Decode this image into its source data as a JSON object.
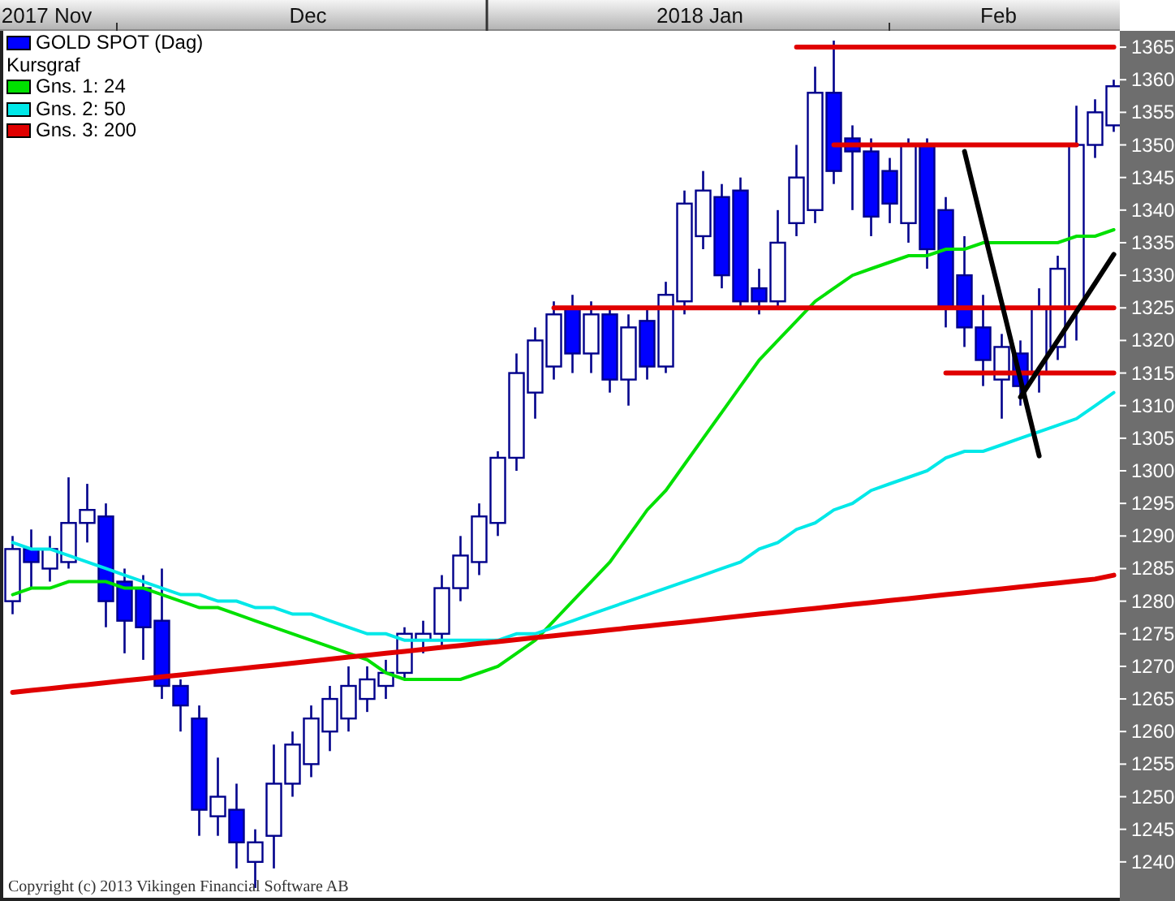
{
  "chart": {
    "price_legend": {
      "label": "GOLD SPOT (Dag)",
      "color": "#0000ff"
    },
    "legend_note": "Kursgraf",
    "copyright": "Copyright (c) 2013 Vikingen Financial Software AB",
    "chart_data": {
      "type": "candlestick",
      "ylim": [
        1234,
        1367.5
      ],
      "legend": "upper left",
      "categories": [
        null,
        null,
        "2017 Nov",
        null,
        null,
        null,
        null,
        null,
        null,
        null,
        null,
        null,
        null,
        null,
        null,
        null,
        "Dec",
        null,
        null,
        null,
        null,
        null,
        null,
        null,
        null,
        null,
        null,
        null,
        null,
        null,
        null,
        null,
        null,
        null,
        null,
        null,
        null,
        "2018 Jan",
        null,
        null,
        null,
        null,
        null,
        null,
        null,
        null,
        null,
        null,
        null,
        null,
        null,
        null,
        null,
        "Feb",
        null,
        null,
        null,
        null,
        null,
        null
      ],
      "yticks": [
        1240,
        1245,
        1250,
        1255,
        1260,
        1265,
        1270,
        1275,
        1280,
        1285,
        1290,
        1295,
        1300,
        1305,
        1310,
        1315,
        1320,
        1325,
        1330,
        1335,
        1340,
        1345,
        1350,
        1355,
        1360,
        1365
      ],
      "ohlc": [
        [
          1280,
          1290,
          1278,
          1288
        ],
        [
          1288,
          1291,
          1282,
          1286
        ],
        [
          1285,
          1290,
          1283,
          1288
        ],
        [
          1286,
          1299,
          1285,
          1292
        ],
        [
          1292,
          1298,
          1289,
          1294
        ],
        [
          1293,
          1295,
          1276,
          1280
        ],
        [
          1283,
          1285,
          1272,
          1277
        ],
        [
          1282,
          1284,
          1271,
          1276
        ],
        [
          1277,
          1285,
          1265,
          1267
        ],
        [
          1267,
          1268,
          1260,
          1264
        ],
        [
          1262,
          1264,
          1244,
          1248
        ],
        [
          1247,
          1256,
          1244,
          1250
        ],
        [
          1248,
          1252,
          1239,
          1243
        ],
        [
          1240,
          1245,
          1236,
          1243
        ],
        [
          1244,
          1258,
          1239,
          1252
        ],
        [
          1252,
          1260,
          1250,
          1258
        ],
        [
          1255,
          1264,
          1253,
          1262
        ],
        [
          1260,
          1267,
          1257,
          1265
        ],
        [
          1262,
          1270,
          1260,
          1267
        ],
        [
          1265,
          1270,
          1263,
          1268
        ],
        [
          1267,
          1271,
          1265,
          1269
        ],
        [
          1269,
          1276,
          1268,
          1275
        ],
        [
          1274,
          1277,
          1272,
          1275
        ],
        [
          1275,
          1284,
          1273,
          1282
        ],
        [
          1282,
          1290,
          1280,
          1287
        ],
        [
          1286,
          1295,
          1284,
          1293
        ],
        [
          1292,
          1303,
          1290,
          1302
        ],
        [
          1302,
          1318,
          1300,
          1315
        ],
        [
          1312,
          1322,
          1308,
          1320
        ],
        [
          1316,
          1326,
          1314,
          1324
        ],
        [
          1325,
          1327,
          1315,
          1318
        ],
        [
          1318,
          1326,
          1315,
          1324
        ],
        [
          1324,
          1325,
          1312,
          1314
        ],
        [
          1314,
          1324,
          1310,
          1322
        ],
        [
          1323,
          1325,
          1314,
          1316
        ],
        [
          1316,
          1329,
          1315,
          1327
        ],
        [
          1326,
          1343,
          1324,
          1341
        ],
        [
          1336,
          1346,
          1334,
          1343
        ],
        [
          1342,
          1344,
          1328,
          1330
        ],
        [
          1343,
          1345,
          1325,
          1326
        ],
        [
          1328,
          1331,
          1324,
          1326
        ],
        [
          1326,
          1340,
          1325,
          1335
        ],
        [
          1338,
          1350,
          1336,
          1345
        ],
        [
          1340,
          1362,
          1338,
          1358
        ],
        [
          1358,
          1366,
          1344,
          1346
        ],
        [
          1351,
          1353,
          1340,
          1349
        ],
        [
          1349,
          1351,
          1336,
          1339
        ],
        [
          1346,
          1348,
          1338,
          1341
        ],
        [
          1338,
          1351,
          1335,
          1350
        ],
        [
          1350,
          1351,
          1331,
          1334
        ],
        [
          1340,
          1342,
          1322,
          1325
        ],
        [
          1330,
          1336,
          1319,
          1322
        ],
        [
          1322,
          1327,
          1313,
          1317
        ],
        [
          1314,
          1321,
          1308,
          1319
        ],
        [
          1318,
          1320,
          1310,
          1313
        ],
        [
          1315,
          1328,
          1312,
          1325
        ],
        [
          1319,
          1333,
          1317,
          1331
        ],
        [
          1325,
          1356,
          1320,
          1350
        ],
        [
          1350,
          1357,
          1348,
          1355
        ],
        [
          1353,
          1360,
          1352,
          1359
        ]
      ],
      "series": [
        {
          "name": "Gns. 1: 24",
          "type": "line",
          "color": "#00e000",
          "values": [
            1281,
            1282,
            1282,
            1283,
            1283,
            1283,
            1282,
            1282,
            1281,
            1280,
            1279,
            1279,
            1278,
            1277,
            1276,
            1275,
            1274,
            1273,
            1272,
            1271,
            1269,
            1268,
            1268,
            1268,
            1268,
            1269,
            1270,
            1272,
            1274,
            1277,
            1280,
            1283,
            1286,
            1290,
            1294,
            1297,
            1301,
            1305,
            1309,
            1313,
            1317,
            1320,
            1323,
            1326,
            1328,
            1330,
            1331,
            1332,
            1333,
            1333,
            1334,
            1334,
            1335,
            1335,
            1335,
            1335,
            1335,
            1336,
            1336,
            1337
          ]
        },
        {
          "name": "Gns. 2: 50",
          "type": "line",
          "color": "#00e8e8",
          "values": [
            1289,
            1288,
            1288,
            1287,
            1286,
            1285,
            1284,
            1283,
            1282,
            1281,
            1281,
            1280,
            1280,
            1279,
            1279,
            1278,
            1278,
            1277,
            1276,
            1275,
            1275,
            1274,
            1274,
            1274,
            1274,
            1274,
            1274,
            1275,
            1275,
            1276,
            1277,
            1278,
            1279,
            1280,
            1281,
            1282,
            1283,
            1284,
            1285,
            1286,
            1288,
            1289,
            1291,
            1292,
            1294,
            1295,
            1297,
            1298,
            1299,
            1300,
            1302,
            1303,
            1303,
            1304,
            1305,
            1306,
            1307,
            1308,
            1310,
            1312
          ]
        },
        {
          "name": "Gns. 3: 200",
          "type": "line",
          "color": "#e00000",
          "values": [
            1266,
            1266.3,
            1266.6,
            1266.9,
            1267.2,
            1267.5,
            1267.8,
            1268.1,
            1268.4,
            1268.7,
            1269,
            1269.3,
            1269.6,
            1269.9,
            1270.2,
            1270.5,
            1270.8,
            1271.1,
            1271.4,
            1271.7,
            1272,
            1272.3,
            1272.6,
            1272.9,
            1273.2,
            1273.5,
            1273.8,
            1274.1,
            1274.4,
            1274.7,
            1275,
            1275.3,
            1275.6,
            1275.9,
            1276.2,
            1276.5,
            1276.8,
            1277.1,
            1277.4,
            1277.7,
            1278,
            1278.3,
            1278.6,
            1278.9,
            1279.2,
            1279.5,
            1279.8,
            1280.1,
            1280.4,
            1280.7,
            1281,
            1281.3,
            1281.6,
            1281.9,
            1282.2,
            1282.5,
            1282.8,
            1283.1,
            1283.4,
            1284
          ]
        },
        {
          "type": "line",
          "color": "#e00000",
          "values": [
            null,
            null,
            null,
            null,
            null,
            null,
            null,
            null,
            null,
            null,
            null,
            null,
            null,
            null,
            null,
            null,
            null,
            null,
            null,
            null,
            null,
            null,
            null,
            null,
            null,
            null,
            null,
            null,
            null,
            null,
            null,
            null,
            null,
            null,
            null,
            null,
            null,
            null,
            null,
            null,
            null,
            null,
            1365,
            1365,
            1365,
            1365,
            1365,
            1365,
            1365,
            1365,
            1365,
            1365,
            1365,
            1365,
            1365,
            1365,
            1365,
            1365,
            1365,
            1365
          ]
        },
        {
          "type": "line",
          "color": "#e00000",
          "values": [
            null,
            null,
            null,
            null,
            null,
            null,
            null,
            null,
            null,
            null,
            null,
            null,
            null,
            null,
            null,
            null,
            null,
            null,
            null,
            null,
            null,
            null,
            null,
            null,
            null,
            null,
            null,
            null,
            null,
            null,
            null,
            null,
            null,
            null,
            null,
            null,
            null,
            null,
            null,
            null,
            null,
            null,
            null,
            null,
            1350,
            1350,
            1350,
            1350,
            1350,
            1350,
            1350,
            1350,
            1350,
            1350,
            1350,
            1350,
            1350,
            1350,
            null,
            null
          ]
        },
        {
          "type": "line",
          "color": "#e00000",
          "values": [
            null,
            null,
            null,
            null,
            null,
            null,
            null,
            null,
            null,
            null,
            null,
            null,
            null,
            null,
            null,
            null,
            null,
            null,
            null,
            null,
            null,
            null,
            null,
            null,
            null,
            null,
            null,
            null,
            null,
            1325,
            1325,
            1325,
            1325,
            1325,
            1325,
            1325,
            1325,
            1325,
            1325,
            1325,
            1325,
            1325,
            1325,
            1325,
            1325,
            1325,
            1325,
            1325,
            1325,
            1325,
            1325,
            1325,
            1325,
            1325,
            1325,
            1325,
            1325,
            1325,
            1325,
            1325
          ]
        },
        {
          "type": "line",
          "color": "#e00000",
          "values": [
            null,
            null,
            null,
            null,
            null,
            null,
            null,
            null,
            null,
            null,
            null,
            null,
            null,
            null,
            null,
            null,
            null,
            null,
            null,
            null,
            null,
            null,
            null,
            null,
            null,
            null,
            null,
            null,
            null,
            null,
            null,
            null,
            null,
            null,
            null,
            null,
            null,
            null,
            null,
            null,
            null,
            null,
            null,
            null,
            null,
            null,
            null,
            null,
            null,
            null,
            1315,
            1315,
            1315,
            1315,
            1315,
            1315,
            1315,
            1315,
            1315,
            1315
          ]
        },
        {
          "type": "line",
          "color": "#000000",
          "values": [
            null,
            null,
            null,
            null,
            null,
            null,
            null,
            null,
            null,
            null,
            null,
            null,
            null,
            null,
            null,
            null,
            null,
            null,
            null,
            null,
            null,
            null,
            null,
            null,
            null,
            null,
            null,
            null,
            null,
            null,
            null,
            null,
            null,
            null,
            null,
            null,
            null,
            null,
            null,
            null,
            null,
            null,
            null,
            null,
            null,
            null,
            null,
            null,
            null,
            null,
            null,
            1349,
            1337.3,
            1325.7,
            1314,
            1302.3,
            null,
            null,
            null,
            null
          ]
        },
        {
          "type": "line",
          "color": "#000000",
          "values": [
            null,
            null,
            null,
            null,
            null,
            null,
            null,
            null,
            null,
            null,
            null,
            null,
            null,
            null,
            null,
            null,
            null,
            null,
            null,
            null,
            null,
            null,
            null,
            null,
            null,
            null,
            null,
            null,
            null,
            null,
            null,
            null,
            null,
            null,
            null,
            null,
            null,
            null,
            null,
            null,
            null,
            null,
            null,
            null,
            null,
            null,
            null,
            null,
            null,
            null,
            null,
            null,
            null,
            null,
            1311.3,
            1315.7,
            1320,
            1324.4,
            1328.8,
            1333.2
          ]
        }
      ]
    }
  }
}
